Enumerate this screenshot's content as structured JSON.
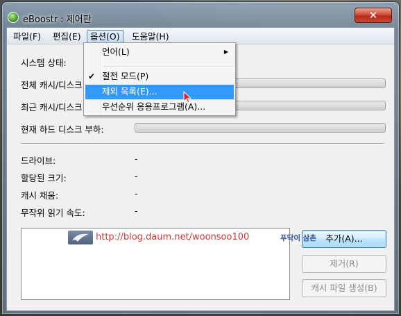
{
  "window": {
    "title": "eBoostr : 제어판",
    "close_glyph": "✕"
  },
  "menubar": {
    "items": [
      {
        "label": "파일(F)"
      },
      {
        "label": "편집(E)"
      },
      {
        "label": "옵션(O)"
      },
      {
        "label": "도움말(H)"
      }
    ]
  },
  "options_menu": {
    "items": [
      {
        "label": "언어(L)",
        "submenu": true
      },
      {
        "label": "절전 모드(P)",
        "checked": true
      },
      {
        "label": "제외 목록(E)...",
        "highlighted": true
      },
      {
        "label": "우선순위 응용프로그램(A)..."
      }
    ],
    "check_glyph": "✔",
    "arrow_glyph": "▶"
  },
  "status": {
    "system_state_label": "시스템 상태:",
    "total_cache_label": "전체 캐시/디스크",
    "recent_cache_label": "최근 캐시/디스크",
    "current_disk_load_label": "현재 하드 디스크 부하:",
    "progress": {
      "total_cache": 0,
      "recent_cache": 0,
      "current_disk_load": 0
    }
  },
  "details": {
    "rows": [
      {
        "label": "드라이브:",
        "value": "-"
      },
      {
        "label": "할당된 크기:",
        "value": "-"
      },
      {
        "label": "캐시 채움:",
        "value": "-"
      },
      {
        "label": "무작위 읽기 속도:",
        "value": "-"
      }
    ]
  },
  "buttons": {
    "add": "추가(A)...",
    "remove": "제거(R)",
    "create_cache": "캐시 파일 생성(B)"
  },
  "watermark": {
    "url": "http://blog.daum.net/woonsoo100",
    "tag": "푸닥이 삼촌"
  },
  "colors": {
    "highlight": "#3399ff",
    "close_button": "#c8442e",
    "watermark_url": "#d03838"
  }
}
